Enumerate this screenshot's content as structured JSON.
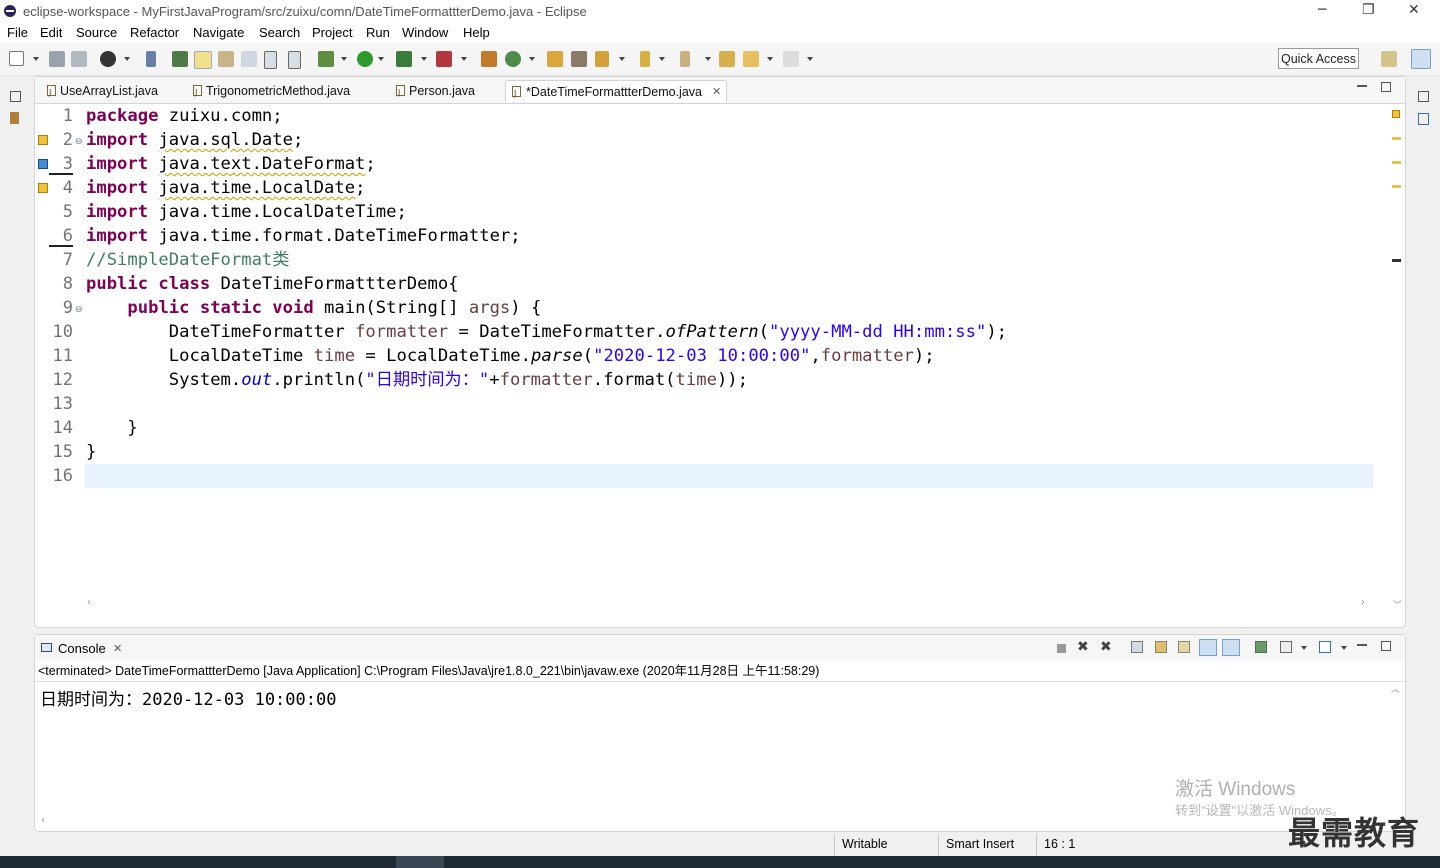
{
  "window": {
    "title": "eclipse-workspace - MyFirstJavaProgram/src/zuixu/comn/DateTimeFormattterDemo.java - Eclipse",
    "minimize": "─",
    "restore": "❐",
    "close": "✕"
  },
  "menu": [
    "File",
    "Edit",
    "Source",
    "Refactor",
    "Navigate",
    "Search",
    "Project",
    "Run",
    "Window",
    "Help"
  ],
  "toolbar": {
    "quick_access": "Quick Access"
  },
  "editor": {
    "tabs": [
      {
        "label": "UseArrayList.java"
      },
      {
        "label": "TrigonometricMethod.java"
      },
      {
        "label": "Person.java"
      },
      {
        "label": "*DateTimeFormattterDemo.java",
        "close": "✕",
        "active": true
      }
    ],
    "line_numbers": [
      "1",
      "2",
      "3",
      "4",
      "5",
      "6",
      "7",
      "8",
      "9",
      "10",
      "11",
      "12",
      "13",
      "14",
      "15",
      "16"
    ],
    "code": {
      "l1_kw": "package",
      "l1_rest": " zuixu.comn;",
      "l2_kw": "import",
      "l2_rest": "java.sql.Date",
      "l2_end": ";",
      "l3_kw": "import",
      "l3_rest": "java.text.DateFormat",
      "l3_end": ";",
      "l4_kw": "import",
      "l4_rest": "java.time.LocalDate",
      "l4_end": ";",
      "l5_kw": "import",
      "l5_rest": " java.time.LocalDateTime;",
      "l6_kw": "import",
      "l6_rest": " java.time.format.DateTimeFormatter;",
      "l7_cmt": "//SimpleDateFormat类",
      "l8_kw": "public class",
      "l8_rest": " DateTimeFormattterDemo{",
      "l9_kw": "public static void",
      "l9_rest": " main(String[] ",
      "l9_var": "args",
      "l9_end": ") {",
      "l10_a": "DateTimeFormatter ",
      "l10_var": "formatter",
      "l10_b": " = DateTimeFormatter.",
      "l10_method": "ofPattern",
      "l10_c": "(",
      "l10_str": "\"yyyy-MM-dd HH:mm:ss\"",
      "l10_d": ");",
      "l11_a": "LocalDateTime ",
      "l11_var": "time",
      "l11_b": " = LocalDateTime.",
      "l11_method": "parse",
      "l11_c": "(",
      "l11_str": "\"2020-12-03 10:00:00\"",
      "l11_d": ",",
      "l11_var2": "formatter",
      "l11_e": ");",
      "l12_a": "System.",
      "l12_field": "out",
      "l12_b": ".println(",
      "l12_str": "\"日期时间为：\"",
      "l12_c": "+",
      "l12_var": "formatter",
      "l12_d": ".format(",
      "l12_var2": "time",
      "l12_e": "));",
      "l14": "}",
      "l15": "}"
    }
  },
  "console": {
    "tab_label": "Console",
    "tab_close": "✕",
    "status": "<terminated> DateTimeFormattterDemo [Java Application] C:\\Program Files\\Java\\jre1.8.0_221\\bin\\javaw.exe (2020年11月28日 上午11:58:29)",
    "output": "日期时间为：2020-12-03 10:00:00"
  },
  "statusbar": {
    "writable": "Writable",
    "insert_mode": "Smart Insert",
    "position": "16 : 1"
  },
  "watermark": {
    "line1": "激活 Windows",
    "line2": "转到\"设置\"以激活 Windows。"
  },
  "brand": "最需教育",
  "colors": {
    "keyword": "#7f0055",
    "string": "#2a00ff",
    "comment": "#3f7f5f",
    "field": "#0000c0",
    "local_var": "#6a3e3e",
    "current_line": "#e8f2fe"
  }
}
